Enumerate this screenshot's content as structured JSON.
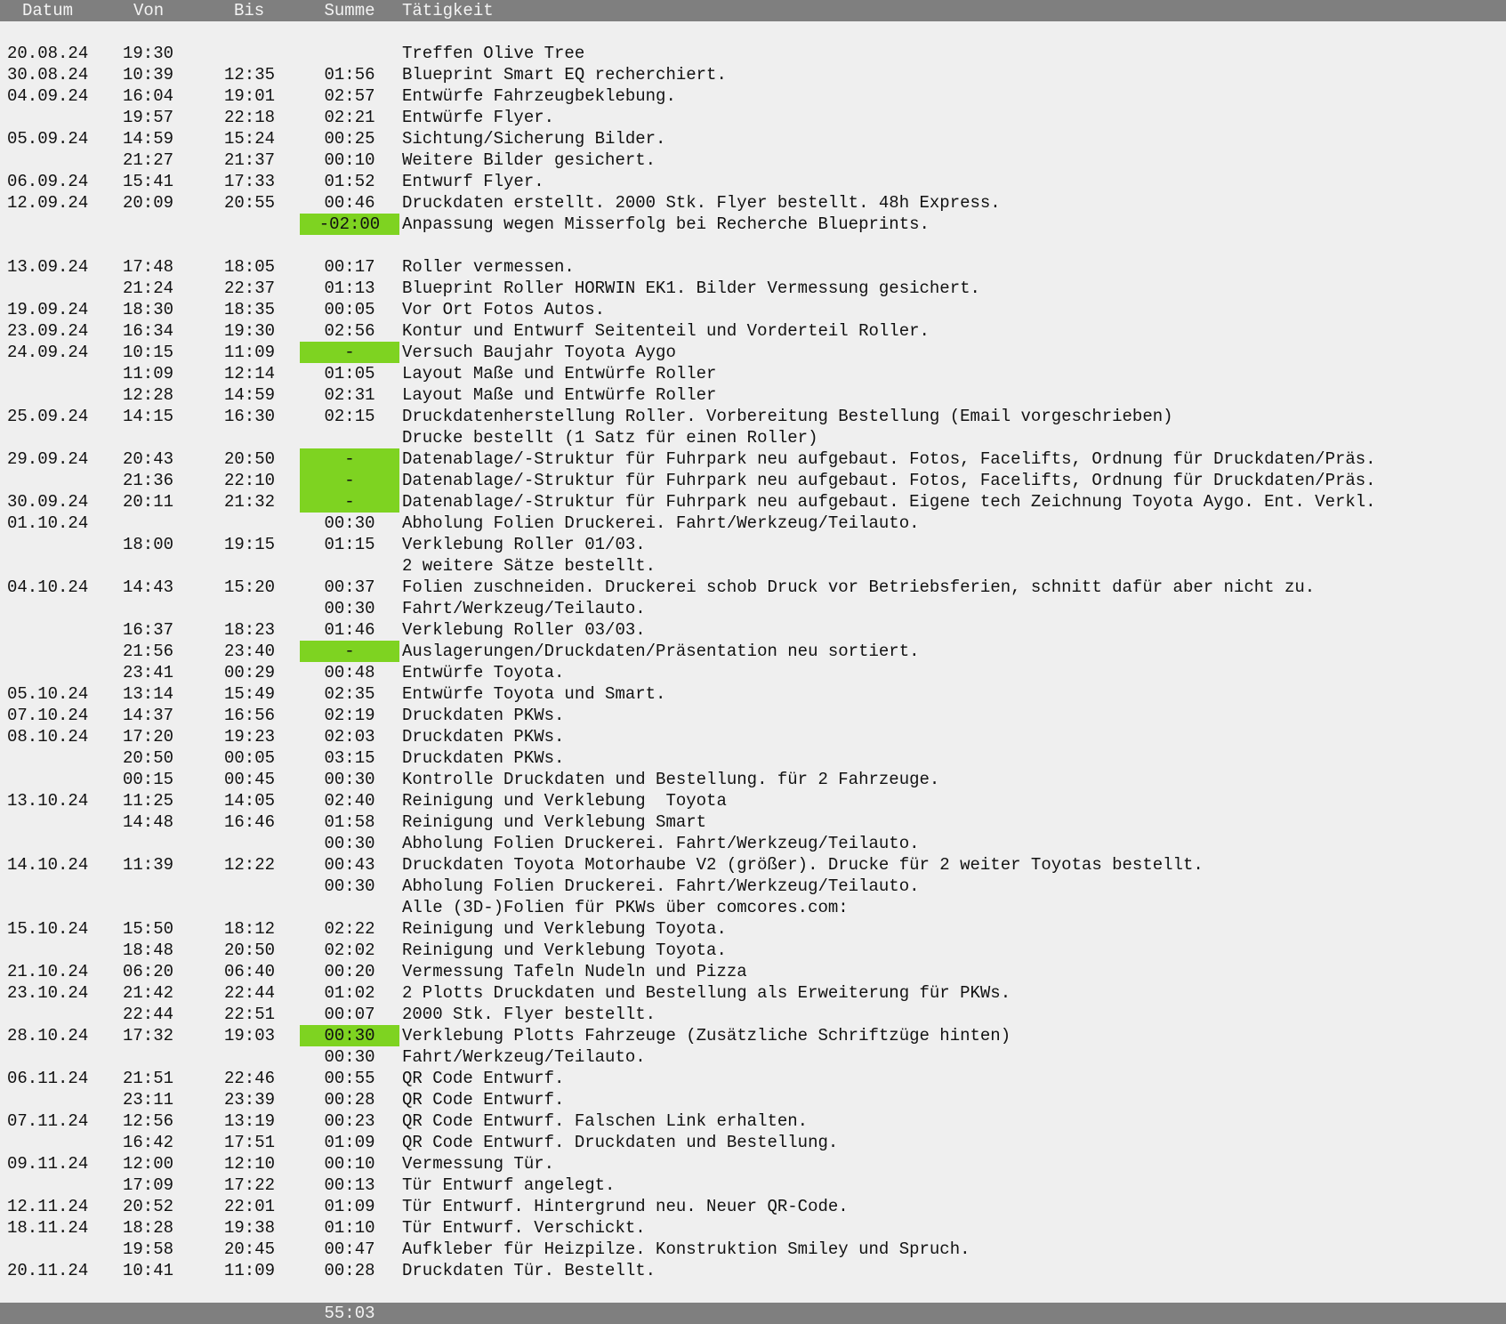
{
  "columns": {
    "datum": "Datum",
    "von": "Von",
    "bis": "Bis",
    "summe": "Summe",
    "taetigkeit": "Tätigkeit"
  },
  "rows": [
    {
      "datum": "20.08.24",
      "von": "19:30",
      "bis": "",
      "summe": "",
      "taetigkeit": "Treffen Olive Tree",
      "highlight": false
    },
    {
      "datum": "30.08.24",
      "von": "10:39",
      "bis": "12:35",
      "summe": "01:56",
      "taetigkeit": "Blueprint Smart EQ recherchiert.",
      "highlight": false
    },
    {
      "datum": "04.09.24",
      "von": "16:04",
      "bis": "19:01",
      "summe": "02:57",
      "taetigkeit": "Entwürfe Fahrzeugbeklebung.",
      "highlight": false
    },
    {
      "datum": "",
      "von": "19:57",
      "bis": "22:18",
      "summe": "02:21",
      "taetigkeit": "Entwürfe Flyer.",
      "highlight": false
    },
    {
      "datum": "05.09.24",
      "von": "14:59",
      "bis": "15:24",
      "summe": "00:25",
      "taetigkeit": "Sichtung/Sicherung Bilder.",
      "highlight": false
    },
    {
      "datum": "",
      "von": "21:27",
      "bis": "21:37",
      "summe": "00:10",
      "taetigkeit": "Weitere Bilder gesichert.",
      "highlight": false
    },
    {
      "datum": "06.09.24",
      "von": "15:41",
      "bis": "17:33",
      "summe": "01:52",
      "taetigkeit": "Entwurf Flyer.",
      "highlight": false
    },
    {
      "datum": "12.09.24",
      "von": "20:09",
      "bis": "20:55",
      "summe": "00:46",
      "taetigkeit": "Druckdaten erstellt. 2000 Stk. Flyer bestellt. 48h Express.",
      "highlight": false
    },
    {
      "datum": "",
      "von": "",
      "bis": "",
      "summe": "-02:00",
      "taetigkeit": "Anpassung wegen Misserfolg bei Recherche Blueprints.",
      "highlight": true
    },
    {
      "datum": "",
      "von": "",
      "bis": "",
      "summe": "",
      "taetigkeit": "",
      "highlight": false
    },
    {
      "datum": "13.09.24",
      "von": "17:48",
      "bis": "18:05",
      "summe": "00:17",
      "taetigkeit": "Roller vermessen.",
      "highlight": false
    },
    {
      "datum": "",
      "von": "21:24",
      "bis": "22:37",
      "summe": "01:13",
      "taetigkeit": "Blueprint Roller HORWIN EK1. Bilder Vermessung gesichert.",
      "highlight": false
    },
    {
      "datum": "19.09.24",
      "von": "18:30",
      "bis": "18:35",
      "summe": "00:05",
      "taetigkeit": "Vor Ort Fotos Autos.",
      "highlight": false
    },
    {
      "datum": "23.09.24",
      "von": "16:34",
      "bis": "19:30",
      "summe": "02:56",
      "taetigkeit": "Kontur und Entwurf Seitenteil und Vorderteil Roller.",
      "highlight": false
    },
    {
      "datum": "24.09.24",
      "von": "10:15",
      "bis": "11:09",
      "summe": "-",
      "taetigkeit": "Versuch Baujahr Toyota Aygo",
      "highlight": true
    },
    {
      "datum": "",
      "von": "11:09",
      "bis": "12:14",
      "summe": "01:05",
      "taetigkeit": "Layout Maße und Entwürfe Roller",
      "highlight": false
    },
    {
      "datum": "",
      "von": "12:28",
      "bis": "14:59",
      "summe": "02:31",
      "taetigkeit": "Layout Maße und Entwürfe Roller",
      "highlight": false
    },
    {
      "datum": "25.09.24",
      "von": "14:15",
      "bis": "16:30",
      "summe": "02:15",
      "taetigkeit": "Druckdatenherstellung Roller. Vorbereitung Bestellung (Email vorgeschrieben)",
      "highlight": false
    },
    {
      "datum": "",
      "von": "",
      "bis": "",
      "summe": "",
      "taetigkeit": "Drucke bestellt (1 Satz für einen Roller)",
      "highlight": false
    },
    {
      "datum": "29.09.24",
      "von": "20:43",
      "bis": "20:50",
      "summe": "-",
      "taetigkeit": "Datenablage/-Struktur für Fuhrpark neu aufgebaut. Fotos, Facelifts, Ordnung für Druckdaten/Präs.",
      "highlight": true
    },
    {
      "datum": "",
      "von": "21:36",
      "bis": "22:10",
      "summe": "-",
      "taetigkeit": "Datenablage/-Struktur für Fuhrpark neu aufgebaut. Fotos, Facelifts, Ordnung für Druckdaten/Präs.",
      "highlight": true
    },
    {
      "datum": "30.09.24",
      "von": "20:11",
      "bis": "21:32",
      "summe": "-",
      "taetigkeit": "Datenablage/-Struktur für Fuhrpark neu aufgebaut. Eigene tech Zeichnung Toyota Aygo. Ent. Verkl.",
      "highlight": true
    },
    {
      "datum": "01.10.24",
      "von": "",
      "bis": "",
      "summe": "00:30",
      "taetigkeit": "Abholung Folien Druckerei. Fahrt/Werkzeug/Teilauto.",
      "highlight": false
    },
    {
      "datum": "",
      "von": "18:00",
      "bis": "19:15",
      "summe": "01:15",
      "taetigkeit": "Verklebung Roller 01/03.",
      "highlight": false
    },
    {
      "datum": "",
      "von": "",
      "bis": "",
      "summe": "",
      "taetigkeit": "2 weitere Sätze bestellt.",
      "highlight": false
    },
    {
      "datum": "04.10.24",
      "von": "14:43",
      "bis": "15:20",
      "summe": "00:37",
      "taetigkeit": "Folien zuschneiden. Druckerei schob Druck vor Betriebsferien, schnitt dafür aber nicht zu.",
      "highlight": false
    },
    {
      "datum": "",
      "von": "",
      "bis": "",
      "summe": "00:30",
      "taetigkeit": "Fahrt/Werkzeug/Teilauto.",
      "highlight": false
    },
    {
      "datum": "",
      "von": "16:37",
      "bis": "18:23",
      "summe": "01:46",
      "taetigkeit": "Verklebung Roller 03/03.",
      "highlight": false
    },
    {
      "datum": "",
      "von": "21:56",
      "bis": "23:40",
      "summe": "-",
      "taetigkeit": "Auslagerungen/Druckdaten/Präsentation neu sortiert.",
      "highlight": true
    },
    {
      "datum": "",
      "von": "23:41",
      "bis": "00:29",
      "summe": "00:48",
      "taetigkeit": "Entwürfe Toyota.",
      "highlight": false
    },
    {
      "datum": "05.10.24",
      "von": "13:14",
      "bis": "15:49",
      "summe": "02:35",
      "taetigkeit": "Entwürfe Toyota und Smart.",
      "highlight": false
    },
    {
      "datum": "07.10.24",
      "von": "14:37",
      "bis": "16:56",
      "summe": "02:19",
      "taetigkeit": "Druckdaten PKWs.",
      "highlight": false
    },
    {
      "datum": "08.10.24",
      "von": "17:20",
      "bis": "19:23",
      "summe": "02:03",
      "taetigkeit": "Druckdaten PKWs.",
      "highlight": false
    },
    {
      "datum": "",
      "von": "20:50",
      "bis": "00:05",
      "summe": "03:15",
      "taetigkeit": "Druckdaten PKWs.",
      "highlight": false
    },
    {
      "datum": "",
      "von": "00:15",
      "bis": "00:45",
      "summe": "00:30",
      "taetigkeit": "Kontrolle Druckdaten und Bestellung. für 2 Fahrzeuge.",
      "highlight": false
    },
    {
      "datum": "13.10.24",
      "von": "11:25",
      "bis": "14:05",
      "summe": "02:40",
      "taetigkeit": "Reinigung und Verklebung  Toyota",
      "highlight": false
    },
    {
      "datum": "",
      "von": "14:48",
      "bis": "16:46",
      "summe": "01:58",
      "taetigkeit": "Reinigung und Verklebung Smart",
      "highlight": false
    },
    {
      "datum": "",
      "von": "",
      "bis": "",
      "summe": "00:30",
      "taetigkeit": "Abholung Folien Druckerei. Fahrt/Werkzeug/Teilauto.",
      "highlight": false
    },
    {
      "datum": "14.10.24",
      "von": "11:39",
      "bis": "12:22",
      "summe": "00:43",
      "taetigkeit": "Druckdaten Toyota Motorhaube V2 (größer). Drucke für 2 weiter Toyotas bestellt.",
      "highlight": false
    },
    {
      "datum": "",
      "von": "",
      "bis": "",
      "summe": "00:30",
      "taetigkeit": "Abholung Folien Druckerei. Fahrt/Werkzeug/Teilauto.",
      "highlight": false
    },
    {
      "datum": "",
      "von": "",
      "bis": "",
      "summe": "",
      "taetigkeit": "Alle (3D-)Folien für PKWs über comcores.com:",
      "highlight": false
    },
    {
      "datum": "15.10.24",
      "von": "15:50",
      "bis": "18:12",
      "summe": "02:22",
      "taetigkeit": "Reinigung und Verklebung Toyota.",
      "highlight": false
    },
    {
      "datum": "",
      "von": "18:48",
      "bis": "20:50",
      "summe": "02:02",
      "taetigkeit": "Reinigung und Verklebung Toyota.",
      "highlight": false
    },
    {
      "datum": "21.10.24",
      "von": "06:20",
      "bis": "06:40",
      "summe": "00:20",
      "taetigkeit": "Vermessung Tafeln Nudeln und Pizza",
      "highlight": false
    },
    {
      "datum": "23.10.24",
      "von": "21:42",
      "bis": "22:44",
      "summe": "01:02",
      "taetigkeit": "2 Plotts Druckdaten und Bestellung als Erweiterung für PKWs.",
      "highlight": false
    },
    {
      "datum": "",
      "von": "22:44",
      "bis": "22:51",
      "summe": "00:07",
      "taetigkeit": "2000 Stk. Flyer bestellt.",
      "highlight": false
    },
    {
      "datum": "28.10.24",
      "von": "17:32",
      "bis": "19:03",
      "summe": "00:30",
      "taetigkeit": "Verklebung Plotts Fahrzeuge (Zusätzliche Schriftzüge hinten)",
      "highlight": true
    },
    {
      "datum": "",
      "von": "",
      "bis": "",
      "summe": "00:30",
      "taetigkeit": "Fahrt/Werkzeug/Teilauto.",
      "highlight": false
    },
    {
      "datum": "06.11.24",
      "von": "21:51",
      "bis": "22:46",
      "summe": "00:55",
      "taetigkeit": "QR Code Entwurf.",
      "highlight": false
    },
    {
      "datum": "",
      "von": "23:11",
      "bis": "23:39",
      "summe": "00:28",
      "taetigkeit": "QR Code Entwurf.",
      "highlight": false
    },
    {
      "datum": "07.11.24",
      "von": "12:56",
      "bis": "13:19",
      "summe": "00:23",
      "taetigkeit": "QR Code Entwurf. Falschen Link erhalten.",
      "highlight": false
    },
    {
      "datum": "",
      "von": "16:42",
      "bis": "17:51",
      "summe": "01:09",
      "taetigkeit": "QR Code Entwurf. Druckdaten und Bestellung.",
      "highlight": false
    },
    {
      "datum": "09.11.24",
      "von": "12:00",
      "bis": "12:10",
      "summe": "00:10",
      "taetigkeit": "Vermessung Tür.",
      "highlight": false
    },
    {
      "datum": "",
      "von": "17:09",
      "bis": "17:22",
      "summe": "00:13",
      "taetigkeit": "Tür Entwurf angelegt.",
      "highlight": false
    },
    {
      "datum": "12.11.24",
      "von": "20:52",
      "bis": "22:01",
      "summe": "01:09",
      "taetigkeit": "Tür Entwurf. Hintergrund neu. Neuer QR-Code.",
      "highlight": false
    },
    {
      "datum": "18.11.24",
      "von": "18:28",
      "bis": "19:38",
      "summe": "01:10",
      "taetigkeit": "Tür Entwurf. Verschickt.",
      "highlight": false
    },
    {
      "datum": "",
      "von": "19:58",
      "bis": "20:45",
      "summe": "00:47",
      "taetigkeit": "Aufkleber für Heizpilze. Konstruktion Smiley und Spruch.",
      "highlight": false
    },
    {
      "datum": "20.11.24",
      "von": "10:41",
      "bis": "11:09",
      "summe": "00:28",
      "taetigkeit": "Druckdaten Tür. Bestellt.",
      "highlight": false
    }
  ],
  "footer": {
    "total": "55:03"
  },
  "colors": {
    "header_bg": "#7f7f7f",
    "page_bg": "#efefef",
    "highlight": "#7ed321"
  }
}
